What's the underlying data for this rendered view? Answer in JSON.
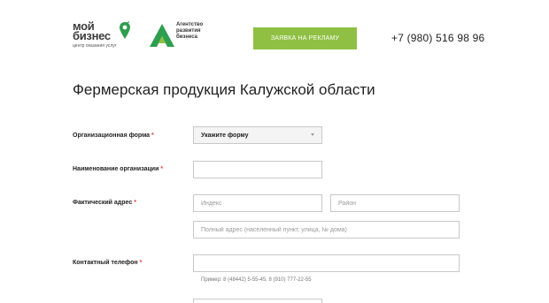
{
  "header": {
    "logo_moy_biznes": {
      "line1": "мой",
      "line2": "бизнес",
      "tagline": "центр оказания услуг"
    },
    "logo_agency": {
      "line1": "Агентство",
      "line2": "развития",
      "line3": "бизнеса"
    },
    "cta_label": "ЗАЯВКА НА РЕКЛАМУ",
    "phone": "+7 (980) 516 98 96",
    "colors": {
      "accent_green": "#8fc043",
      "logo_green": "#2e9e4f"
    }
  },
  "page": {
    "title": "Фермерская продукция Калужской области"
  },
  "form": {
    "org_form": {
      "label": "Организационная форма",
      "required_mark": "*",
      "selected": "Укажите форму"
    },
    "org_name": {
      "label": "Наименование организации",
      "required_mark": "*",
      "value": ""
    },
    "address": {
      "label": "Фактический адрес",
      "required_mark": "*",
      "index_placeholder": "Индекс",
      "district_placeholder": "Район",
      "full_placeholder": "Полный адрес (населенный пункт, улица, № дома)"
    },
    "phone": {
      "label": "Контактный телефон",
      "required_mark": "*",
      "value": "",
      "hint": "Пример: 8 (48442) 5-55-45, 8 (910) 777-22-55"
    }
  }
}
